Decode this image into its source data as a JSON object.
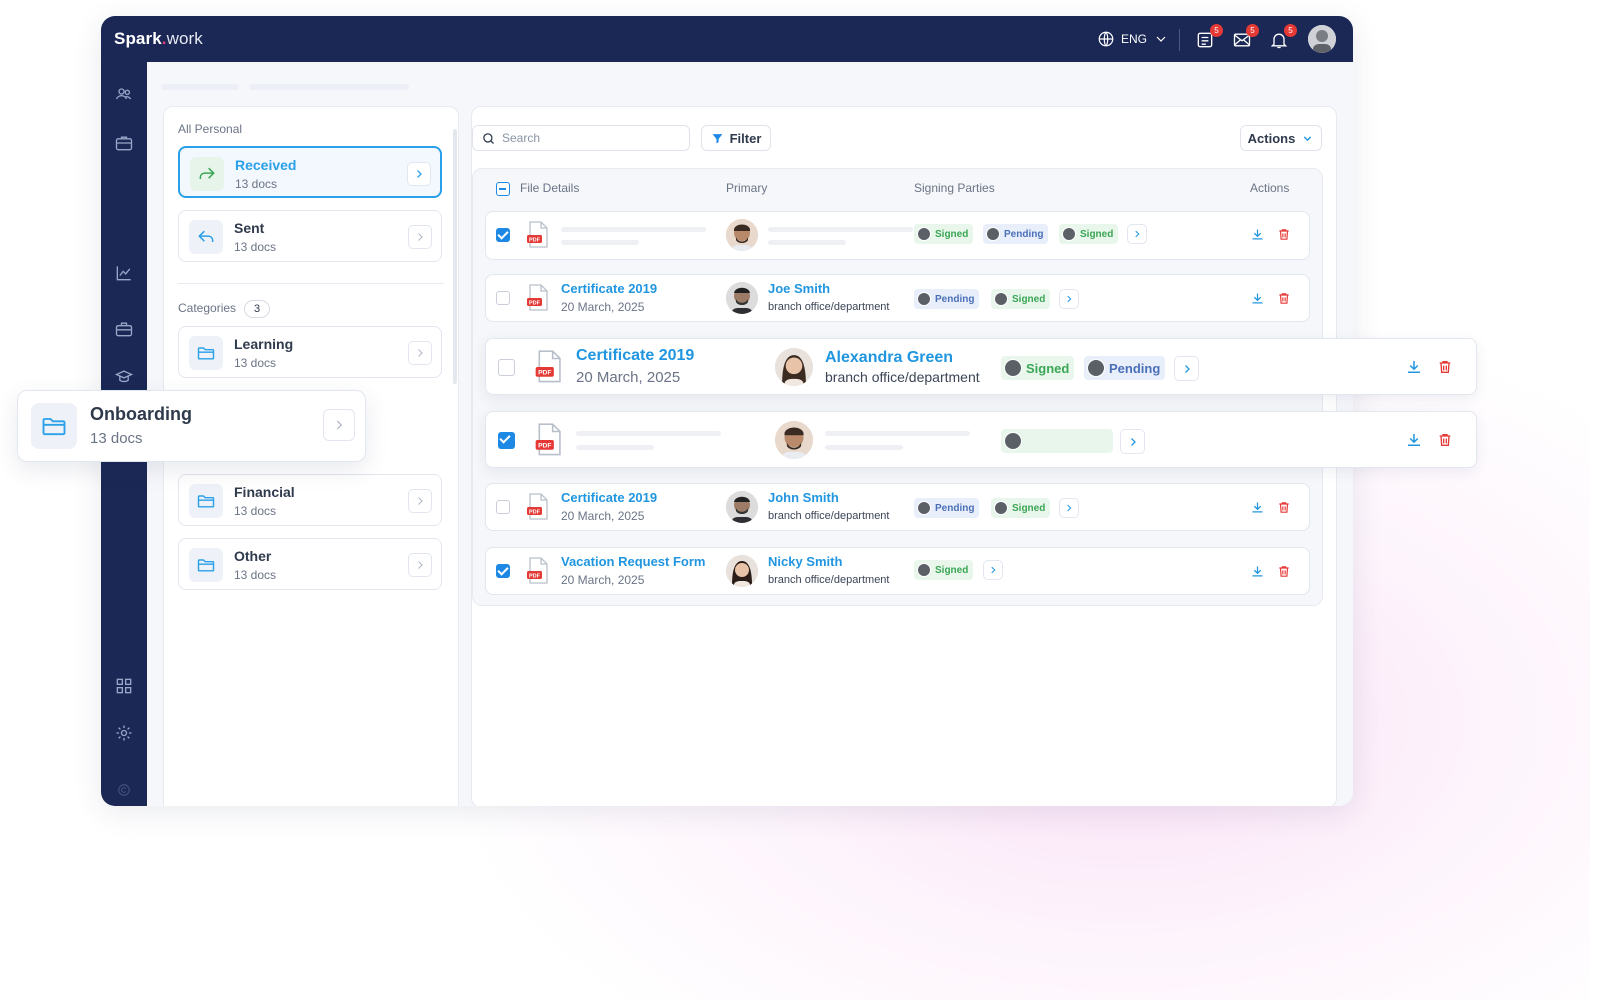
{
  "header": {
    "logo_bold": "Spark",
    "logo_dot": ".",
    "logo_light": "work",
    "language": "ENG",
    "tasks_badge": "5",
    "messages_badge": "5",
    "notifications_badge": "5"
  },
  "left_panel": {
    "all_personal_label": "All Personal",
    "received": {
      "title": "Received",
      "count": "13 docs"
    },
    "sent": {
      "title": "Sent",
      "count": "13 docs"
    },
    "categories_label": "Categories",
    "categories_count": "3",
    "categories": [
      {
        "title": "Learning",
        "count": "13 docs"
      },
      {
        "title": "Financial",
        "count": "13 docs"
      },
      {
        "title": "Other",
        "count": "13 docs"
      }
    ],
    "onboarding": {
      "title": "Onboarding",
      "count": "13 docs"
    }
  },
  "toolbar": {
    "search_placeholder": "Search",
    "filter_label": "Filter",
    "actions_label": "Actions"
  },
  "table": {
    "columns": [
      "File Details",
      "Primary",
      "Signing Parties",
      "Actions"
    ],
    "rows": [
      {
        "checked": true,
        "file": "",
        "date": "",
        "person": "",
        "dept": "",
        "parties": [
          "Signed",
          "Pending",
          "Signed"
        ]
      },
      {
        "checked": false,
        "file": "Certificate 2019",
        "date": "20 March, 2025",
        "person": "Joe Smith",
        "dept": "branch office/department",
        "parties": [
          "Pending",
          "Signed"
        ]
      },
      {
        "checked": false,
        "file": "Certificate 2019",
        "date": "20 March, 2025",
        "person": "Alexandra Green",
        "dept": "branch office/department",
        "parties": [
          "Signed",
          "Pending"
        ]
      },
      {
        "checked": true,
        "file": "",
        "date": "",
        "person": "",
        "dept": "",
        "parties": []
      },
      {
        "checked": false,
        "file": "Certificate 2019",
        "date": "20 March, 2025",
        "person": "John Smith",
        "dept": "branch office/department",
        "parties": [
          "Pending",
          "Signed"
        ]
      },
      {
        "checked": true,
        "file": "Vacation Request Form",
        "date": "20 March, 2025",
        "person": "Nicky Smith",
        "dept": "branch office/department",
        "parties": [
          "Signed"
        ]
      }
    ]
  },
  "colors": {
    "navy": "#1b2856",
    "accent_blue": "#2196e0",
    "signed_green": "#3aa655",
    "pending_blue": "#4a6fb8",
    "delete_red": "#e53935",
    "badge_red": "#e53935"
  },
  "icons": [
    "globe-icon",
    "chevron-down-icon",
    "tasks-icon",
    "mail-icon",
    "bell-icon",
    "users-icon",
    "briefcase-icon",
    "chart-icon",
    "toolbox-icon",
    "school-icon",
    "grid-icon",
    "gear-icon",
    "search-icon",
    "filter-icon",
    "folder-icon",
    "received-icon",
    "sent-icon",
    "pdf-icon",
    "download-icon",
    "trash-icon",
    "chevron-right-icon"
  ]
}
